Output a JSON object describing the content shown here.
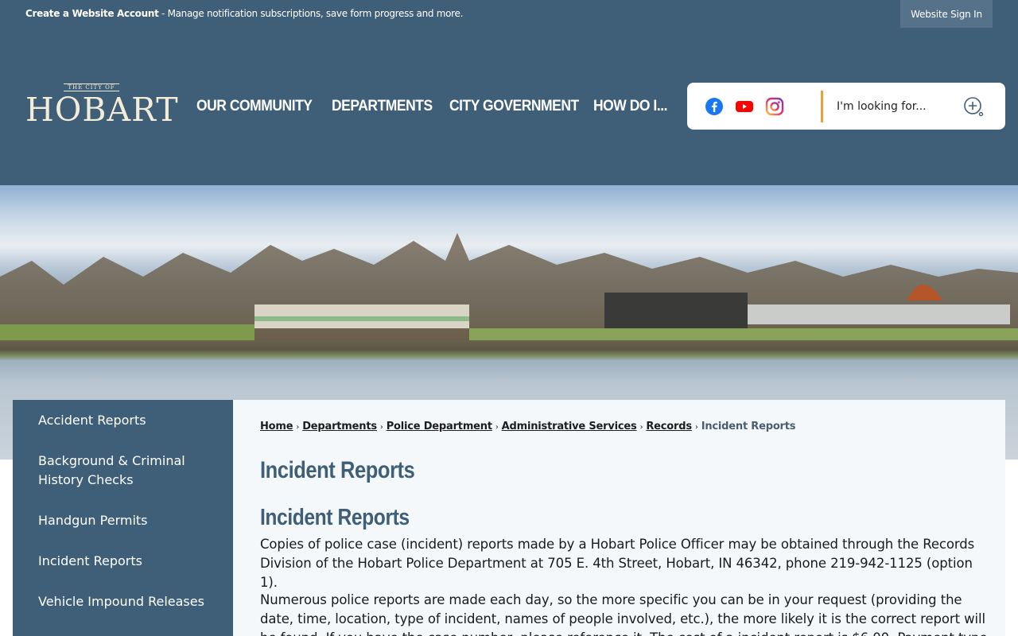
{
  "topbar": {
    "account_bold": "Create a Website Account",
    "account_rest": " - Manage notification subscriptions, save form progress and more.",
    "sign_in": "Website Sign In"
  },
  "logo": {
    "small": "THE CITY OF",
    "big": "HOBART"
  },
  "nav": [
    "OUR COMMUNITY",
    "DEPARTMENTS",
    "CITY GOVERNMENT",
    "HOW DO I..."
  ],
  "search": {
    "placeholder": "I'm looking for..."
  },
  "icons": {
    "facebook": "facebook-icon",
    "youtube": "youtube-icon",
    "instagram": "instagram-icon",
    "search": "search-icon"
  },
  "colors": {
    "primary": "#3f5e78",
    "accent": "#e3a23a",
    "content_bg": "#f4f8fb",
    "facebook": "#1877f2",
    "youtube": "#ff0000"
  },
  "sidebar": [
    "Accident Reports",
    "Background & Criminal History Checks",
    "Handgun Permits",
    "Incident Reports",
    "Vehicle Impound Releases"
  ],
  "breadcrumb": {
    "links": [
      "Home",
      "Departments",
      "Police Department",
      "Administrative Services",
      "Records"
    ],
    "current": "Incident Reports"
  },
  "content": {
    "page_title": "Incident Reports",
    "section_title": "Incident Reports",
    "para1": "Copies of police case (incident) reports made by a Hobart Police Officer may be obtained through the Records Division of the Hobart Police Department at 705 E. 4th Street, Hobart, IN 46342, phone 219-942-1125 (option 1).",
    "para2": "Numerous police reports are made each day, so the more specific you can be in your request (providing the date, time, location, type of incident, names of people involved, etc.), the more likely it is the correct report will be found. If you have the case number, please reference it. The cost of a incident report is $6.00. Payment type"
  }
}
